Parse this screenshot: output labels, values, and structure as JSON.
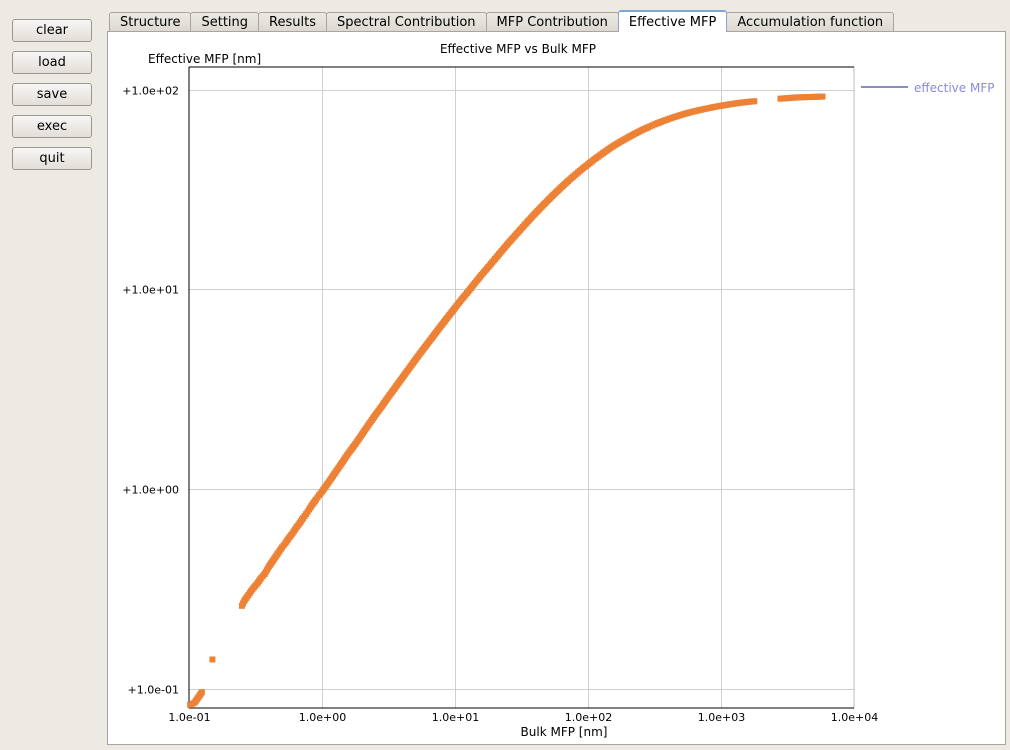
{
  "sidebar": {
    "buttons": [
      {
        "label": "clear"
      },
      {
        "label": "load"
      },
      {
        "label": "save"
      },
      {
        "label": "exec"
      },
      {
        "label": "quit"
      }
    ]
  },
  "tabs": [
    {
      "label": "Structure",
      "active": false
    },
    {
      "label": "Setting",
      "active": false
    },
    {
      "label": "Results",
      "active": false
    },
    {
      "label": "Spectral Contribution",
      "active": false
    },
    {
      "label": "MFP Contribution",
      "active": false
    },
    {
      "label": "Effective MFP",
      "active": true
    },
    {
      "label": "Accumulation function",
      "active": false
    }
  ],
  "chart_data": {
    "type": "scatter",
    "title": "Effective MFP vs Bulk MFP",
    "xlabel": "Bulk MFP [nm]",
    "ylabel": "Effective MFP [nm]",
    "xscale": "log",
    "yscale": "log",
    "xlim": [
      0.1,
      10000
    ],
    "ylim": [
      0.08,
      130
    ],
    "grid": true,
    "legend_position": "right",
    "xticks": [
      {
        "value": 0.1,
        "label": "1.0e-01"
      },
      {
        "value": 1,
        "label": "1.0e+00"
      },
      {
        "value": 10,
        "label": "1.0e+01"
      },
      {
        "value": 100,
        "label": "1.0e+02"
      },
      {
        "value": 1000,
        "label": "1.0e+03"
      },
      {
        "value": 10000,
        "label": "1.0e+04"
      }
    ],
    "yticks": [
      {
        "value": 0.1,
        "label": "+1.0e-01"
      },
      {
        "value": 1,
        "label": "+1.0e+00"
      },
      {
        "value": 10,
        "label": "+1.0e+01"
      },
      {
        "value": 100,
        "label": "+1.0e+02"
      }
    ],
    "series": [
      {
        "name": "effective MFP",
        "color": "#ed8236",
        "legend_color": "#8a87e6",
        "legend_line_color": "#1a1a7a",
        "points": [
          [
            0.102,
            0.083
          ],
          [
            0.11,
            0.085
          ],
          [
            0.125,
            0.096
          ],
          [
            0.15,
            0.14
          ],
          [
            0.25,
            0.26
          ],
          [
            0.26,
            0.275
          ],
          [
            0.28,
            0.295
          ],
          [
            0.3,
            0.315
          ],
          [
            0.33,
            0.34
          ],
          [
            0.35,
            0.36
          ],
          [
            0.37,
            0.375
          ],
          [
            0.4,
            0.41
          ],
          [
            0.43,
            0.44
          ],
          [
            0.47,
            0.48
          ],
          [
            0.5,
            0.51
          ],
          [
            0.53,
            0.535
          ],
          [
            0.56,
            0.565
          ],
          [
            0.6,
            0.6
          ],
          [
            0.64,
            0.64
          ],
          [
            0.68,
            0.675
          ],
          [
            0.72,
            0.715
          ],
          [
            0.76,
            0.75
          ],
          [
            0.8,
            0.79
          ],
          [
            0.85,
            0.84
          ],
          [
            0.9,
            0.885
          ],
          [
            0.95,
            0.93
          ],
          [
            1.0,
            0.97
          ],
          [
            1.12,
            1.08
          ],
          [
            1.26,
            1.21
          ],
          [
            1.41,
            1.35
          ],
          [
            1.58,
            1.51
          ],
          [
            1.78,
            1.68
          ],
          [
            2.0,
            1.88
          ],
          [
            2.24,
            2.1
          ],
          [
            2.51,
            2.34
          ],
          [
            2.82,
            2.6
          ],
          [
            3.16,
            2.9
          ],
          [
            3.55,
            3.22
          ],
          [
            3.98,
            3.58
          ],
          [
            4.47,
            3.98
          ],
          [
            5.01,
            4.42
          ],
          [
            5.62,
            4.9
          ],
          [
            6.31,
            5.42
          ],
          [
            7.08,
            6.0
          ],
          [
            7.94,
            6.63
          ],
          [
            8.91,
            7.32
          ],
          [
            10.0,
            8.08
          ],
          [
            11.2,
            8.9
          ],
          [
            12.6,
            9.78
          ],
          [
            14.1,
            10.75
          ],
          [
            15.8,
            11.8
          ],
          [
            17.8,
            12.95
          ],
          [
            20.0,
            14.2
          ],
          [
            22.4,
            15.55
          ],
          [
            25.1,
            17.0
          ],
          [
            28.2,
            18.55
          ],
          [
            31.6,
            20.2
          ],
          [
            35.5,
            22.0
          ],
          [
            39.8,
            23.9
          ],
          [
            44.7,
            25.9
          ],
          [
            50.1,
            28.0
          ],
          [
            56.2,
            30.2
          ],
          [
            63.1,
            32.5
          ],
          [
            70.8,
            34.9
          ],
          [
            79.4,
            37.3
          ],
          [
            89.1,
            39.8
          ],
          [
            100.0,
            42.3
          ],
          [
            112.0,
            44.9
          ],
          [
            126.0,
            47.5
          ],
          [
            141.0,
            50.1
          ],
          [
            158.0,
            52.7
          ],
          [
            178.0,
            55.2
          ],
          [
            200.0,
            57.7
          ],
          [
            224.0,
            60.1
          ],
          [
            251.0,
            62.5
          ],
          [
            282.0,
            64.8
          ],
          [
            316.0,
            67.0
          ],
          [
            355.0,
            69.1
          ],
          [
            398.0,
            71.1
          ],
          [
            447.0,
            73.0
          ],
          [
            501.0,
            74.8
          ],
          [
            562.0,
            76.5
          ],
          [
            631.0,
            78.0
          ],
          [
            708.0,
            79.4
          ],
          [
            794.0,
            80.7
          ],
          [
            891.0,
            82.0
          ],
          [
            1000.0,
            83.1
          ],
          [
            1120.0,
            84.2
          ],
          [
            1260.0,
            85.2
          ],
          [
            1410.0,
            86.1
          ],
          [
            1580.0,
            86.9
          ],
          [
            1780.0,
            87.6
          ],
          [
            2800.0,
            90.2
          ],
          [
            3700.0,
            91.5
          ],
          [
            4700.0,
            92.0
          ],
          [
            5200.0,
            92.2
          ],
          [
            5800.0,
            92.4
          ]
        ]
      }
    ]
  }
}
